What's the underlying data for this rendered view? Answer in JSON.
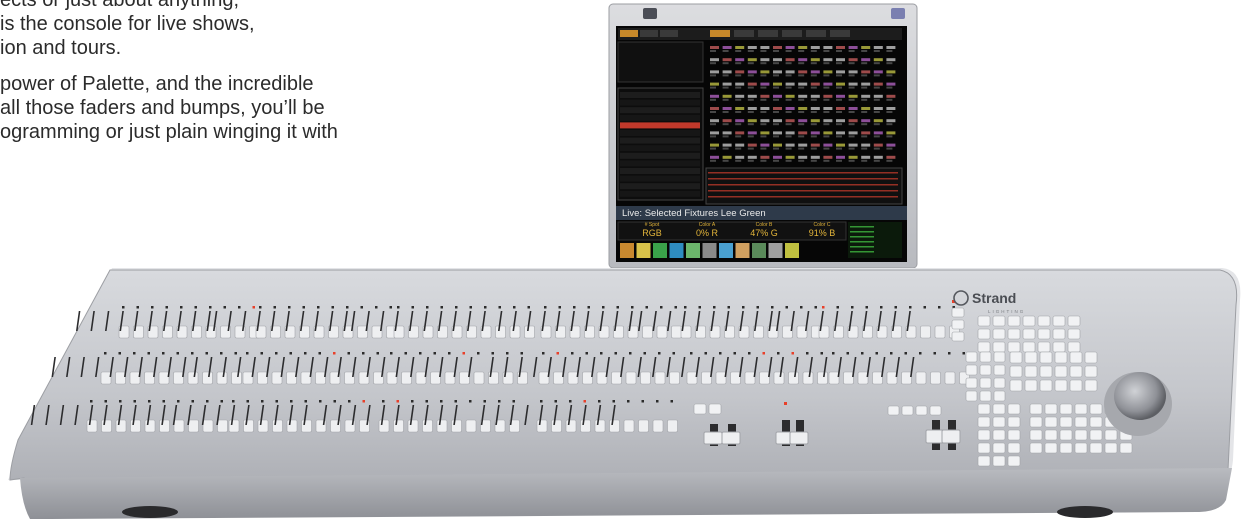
{
  "copy": {
    "para1": [
      "ects or just about anything,",
      "is the console for live shows,",
      "ion and tours."
    ],
    "para2": [
      "power of Palette, and the incredible",
      "all those faders and bumps, you’ll be",
      "ogramming or just plain winging it with"
    ]
  },
  "monitor": {
    "live_label": "Live: Selected Fixtures Lee Green",
    "params": [
      {
        "name": "# Spot",
        "value": "RGB"
      },
      {
        "name": "Color A",
        "value": "0% R"
      },
      {
        "name": "Color B",
        "value": "47% G"
      },
      {
        "name": "Color C",
        "value": "91% B"
      }
    ]
  },
  "console": {
    "logo_text": "Strand",
    "logo_sub": "LIGHTING"
  },
  "colors": {
    "console_body": "#c9cbd0",
    "lcd_background": "#060606",
    "indicator_led": "#e8402a",
    "lcd_amber": "#e3b53a"
  }
}
